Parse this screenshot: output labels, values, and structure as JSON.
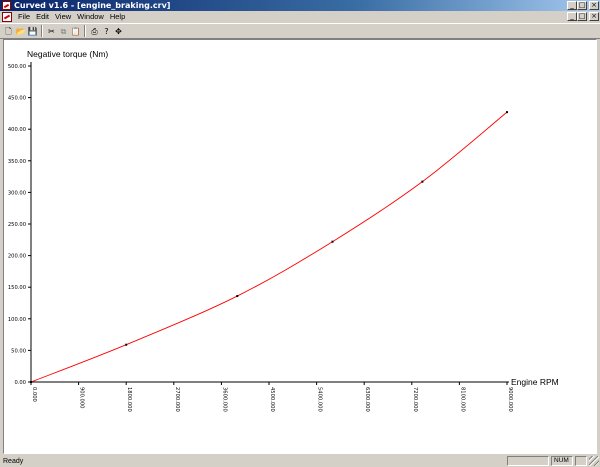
{
  "window": {
    "title": "Curved v1.6 - [engine_braking.crv]",
    "buttons": {
      "minimize": "_",
      "maximize": "□",
      "close": "×"
    }
  },
  "menu": [
    "File",
    "Edit",
    "View",
    "Window",
    "Help"
  ],
  "toolbar": [
    {
      "name": "new-icon",
      "glyph": "🗋",
      "enabled": true
    },
    {
      "name": "open-icon",
      "glyph": "📂",
      "enabled": true
    },
    {
      "name": "save-icon",
      "glyph": "💾",
      "enabled": true
    },
    {
      "name": "cut-icon",
      "glyph": "✂",
      "enabled": true
    },
    {
      "name": "copy-icon",
      "glyph": "⧉",
      "enabled": false
    },
    {
      "name": "paste-icon",
      "glyph": "📋",
      "enabled": false
    },
    {
      "name": "print-icon",
      "glyph": "⎙",
      "enabled": true
    },
    {
      "name": "help-icon",
      "glyph": "?",
      "enabled": true
    },
    {
      "name": "move-icon",
      "glyph": "✥",
      "enabled": true
    }
  ],
  "status": {
    "text": "Ready",
    "num": "NUM"
  },
  "colors": {
    "curve": "#ff0000",
    "point": "#000000",
    "axis": "#000000"
  },
  "chart_data": {
    "type": "line",
    "ylabel": "Negative torque (Nm)",
    "xlabel": "Engine RPM",
    "xlim": [
      0,
      9000
    ],
    "ylim": [
      0,
      500
    ],
    "y_ticks": [
      "0.00",
      "50.00",
      "100.00",
      "150.00",
      "200.00",
      "250.00",
      "300.00",
      "350.00",
      "400.00",
      "450.00",
      "500.00"
    ],
    "x_ticks": [
      "0.000",
      "900.000",
      "1800.000",
      "2700.000",
      "3600.000",
      "4500.000",
      "5400.000",
      "6300.000",
      "7200.000",
      "8100.000",
      "9000.000"
    ],
    "x_tick_values": [
      0,
      900,
      1800,
      2700,
      3600,
      4500,
      5400,
      6300,
      7200,
      8100,
      9000
    ],
    "y_tick_values": [
      0,
      50,
      100,
      150,
      200,
      250,
      300,
      350,
      400,
      450,
      500
    ],
    "x": [
      0,
      1800,
      3900,
      5700,
      7400,
      9000
    ],
    "y": [
      0,
      59,
      136,
      222,
      317,
      427
    ]
  }
}
